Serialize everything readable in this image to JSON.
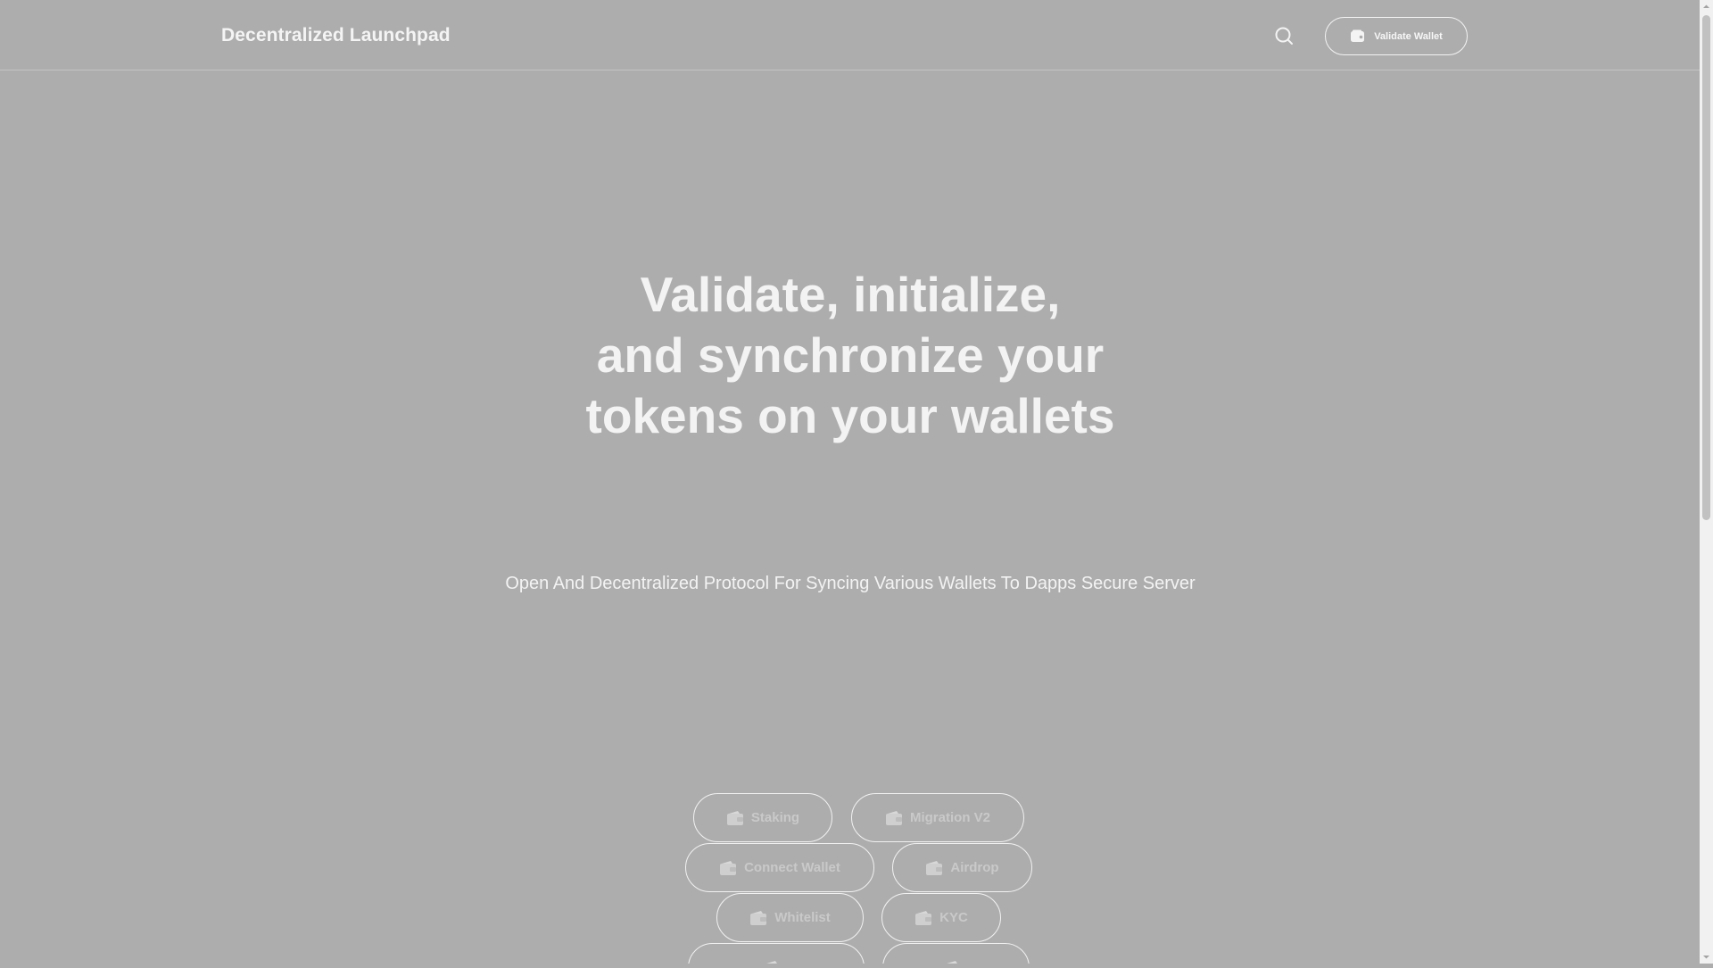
{
  "header": {
    "brand": "Decentralized Launchpad",
    "validate_label": "Validate Wallet",
    "icons": {
      "search": "search-icon",
      "wallet": "wallet-icon"
    }
  },
  "hero": {
    "title_lines": [
      "Validate, initialize,",
      "and synchronize your",
      "tokens on your wallets"
    ],
    "subtitle": "Open And Decentralized Protocol For Syncing Various Wallets To Dapps Secure Server"
  },
  "actions": [
    {
      "label": "Staking",
      "icon": "wallet-icon"
    },
    {
      "label": "Migration V2",
      "icon": "wallet-icon"
    },
    {
      "label": "Connect Wallet",
      "icon": "wallet-icon"
    },
    {
      "label": "Airdrop",
      "icon": "wallet-icon"
    },
    {
      "label": "Whitelist",
      "icon": "wallet-icon"
    },
    {
      "label": "KYC",
      "icon": "wallet-icon"
    },
    {
      "label": "",
      "icon": "wallet-icon"
    },
    {
      "label": "",
      "icon": "wallet-icon"
    }
  ],
  "colors": {
    "background": "#adadad",
    "text": "#f3f3f3",
    "pill_text": "#c9c9c9",
    "divider": "#c4c4c4"
  }
}
